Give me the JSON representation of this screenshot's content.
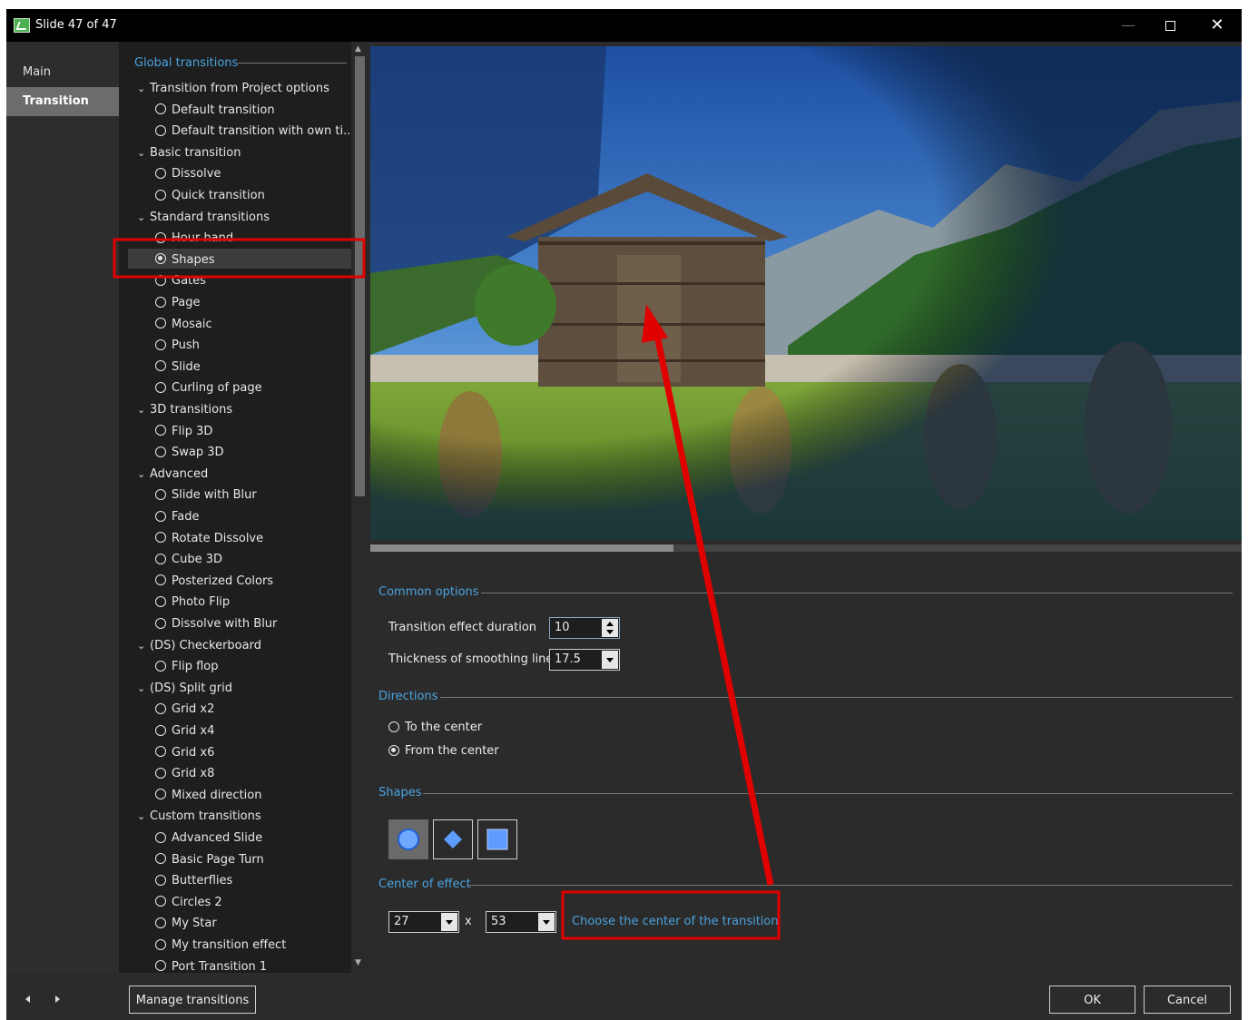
{
  "window": {
    "title": "Slide 47 of 47"
  },
  "nav": {
    "items": [
      "Main",
      "Transition"
    ],
    "active": "Transition"
  },
  "tree": {
    "header": "Global transitions",
    "rows": [
      {
        "type": "group",
        "label": "Transition from Project options"
      },
      {
        "type": "item",
        "label": "Default transition",
        "checked": false
      },
      {
        "type": "item",
        "label": "Default transition with own ti...",
        "checked": false
      },
      {
        "type": "group",
        "label": "Basic transition"
      },
      {
        "type": "item",
        "label": "Dissolve",
        "checked": false
      },
      {
        "type": "item",
        "label": "Quick transition",
        "checked": false
      },
      {
        "type": "group",
        "label": "Standard transitions"
      },
      {
        "type": "item",
        "label": "Hour hand",
        "checked": false
      },
      {
        "type": "item",
        "label": "Shapes",
        "checked": true
      },
      {
        "type": "item",
        "label": "Gates",
        "checked": false
      },
      {
        "type": "item",
        "label": "Page",
        "checked": false
      },
      {
        "type": "item",
        "label": "Mosaic",
        "checked": false
      },
      {
        "type": "item",
        "label": "Push",
        "checked": false
      },
      {
        "type": "item",
        "label": "Slide",
        "checked": false
      },
      {
        "type": "item",
        "label": "Curling of page",
        "checked": false
      },
      {
        "type": "group",
        "label": "3D transitions"
      },
      {
        "type": "item",
        "label": "Flip 3D",
        "checked": false
      },
      {
        "type": "item",
        "label": "Swap 3D",
        "checked": false
      },
      {
        "type": "group",
        "label": "Advanced"
      },
      {
        "type": "item",
        "label": "Slide with Blur",
        "checked": false
      },
      {
        "type": "item",
        "label": "Fade",
        "checked": false
      },
      {
        "type": "item",
        "label": "Rotate Dissolve",
        "checked": false
      },
      {
        "type": "item",
        "label": "Cube 3D",
        "checked": false
      },
      {
        "type": "item",
        "label": "Posterized Colors",
        "checked": false
      },
      {
        "type": "item",
        "label": "Photo Flip",
        "checked": false
      },
      {
        "type": "item",
        "label": "Dissolve with Blur",
        "checked": false
      },
      {
        "type": "group",
        "label": "(DS) Checkerboard"
      },
      {
        "type": "item",
        "label": "Flip flop",
        "checked": false
      },
      {
        "type": "group",
        "label": "(DS) Split grid"
      },
      {
        "type": "item",
        "label": "Grid x2",
        "checked": false
      },
      {
        "type": "item",
        "label": "Grid x4",
        "checked": false
      },
      {
        "type": "item",
        "label": "Grid x6",
        "checked": false
      },
      {
        "type": "item",
        "label": "Grid x8",
        "checked": false
      },
      {
        "type": "item",
        "label": "Mixed direction",
        "checked": false
      },
      {
        "type": "group",
        "label": "Custom transitions"
      },
      {
        "type": "item",
        "label": "Advanced Slide",
        "checked": false
      },
      {
        "type": "item",
        "label": "Basic Page Turn",
        "checked": false
      },
      {
        "type": "item",
        "label": "Butterflies",
        "checked": false
      },
      {
        "type": "item",
        "label": "Circles 2",
        "checked": false
      },
      {
        "type": "item",
        "label": "My Star",
        "checked": false
      },
      {
        "type": "item",
        "label": "My transition effect",
        "checked": false
      },
      {
        "type": "item",
        "label": "Port Transition 1",
        "checked": false
      }
    ]
  },
  "common": {
    "title": "Common options",
    "duration_label": "Transition effect duration",
    "duration_value": "10",
    "thickness_label": "Thickness of smoothing line",
    "thickness_value": "17.5"
  },
  "directions": {
    "title": "Directions",
    "to_center": "To the center",
    "from_center": "From the center",
    "selected": "From the center"
  },
  "shapes": {
    "title": "Shapes",
    "options": [
      "circle",
      "diamond",
      "square"
    ],
    "selected": "circle"
  },
  "center": {
    "title": "Center of effect",
    "x_value": "27",
    "sep": "x",
    "y_value": "53",
    "link": "Choose the center of the transition"
  },
  "footer": {
    "manage": "Manage transitions",
    "ok": "OK",
    "cancel": "Cancel"
  },
  "colors": {
    "accent": "#4aa3df",
    "annotation": "#e00000",
    "background": "#2b2b2b"
  }
}
